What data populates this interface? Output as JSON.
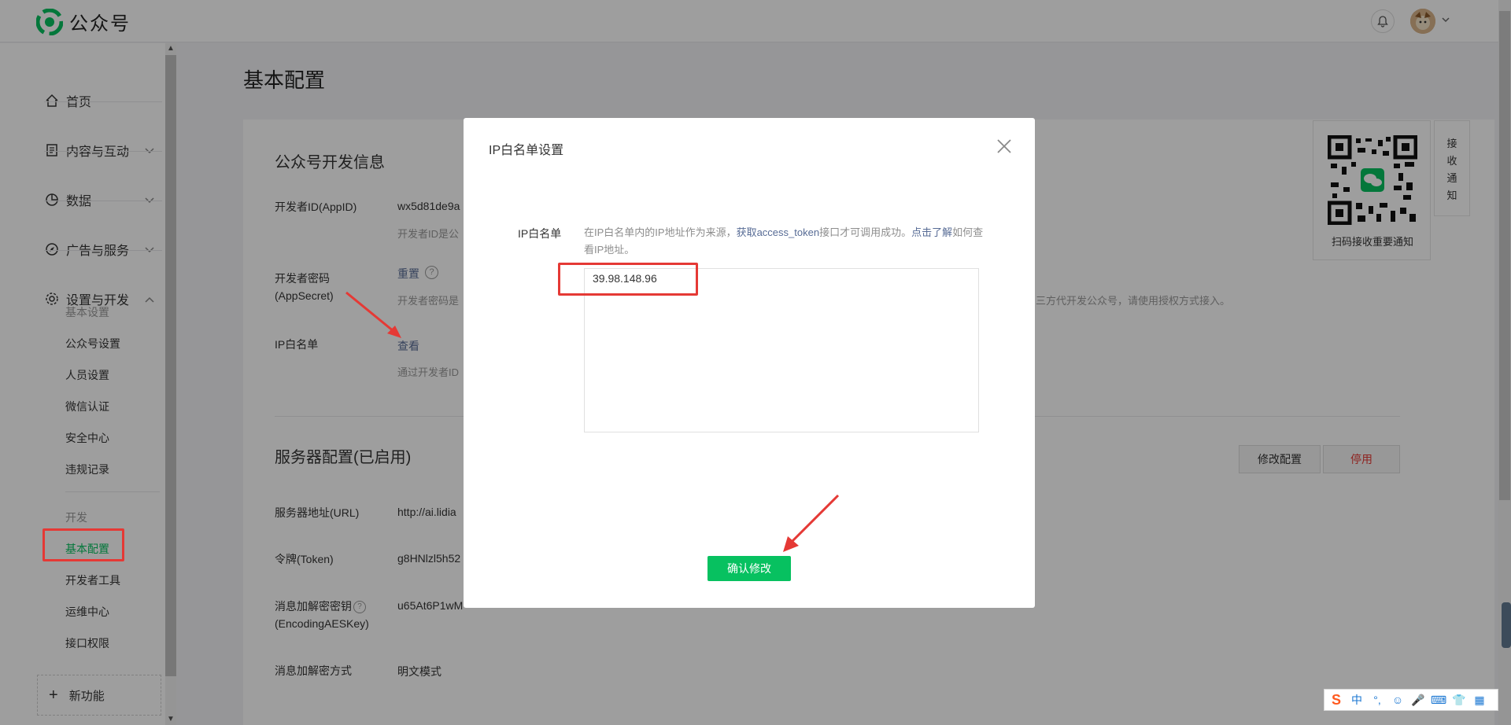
{
  "app": {
    "name": "公众号",
    "brand_color": "#07c160"
  },
  "sidebar": {
    "nav": [
      {
        "label": "首页",
        "icon": "home-icon"
      },
      {
        "label": "内容与互动",
        "icon": "document-icon"
      },
      {
        "label": "数据",
        "icon": "pie-chart-icon"
      },
      {
        "label": "广告与服务",
        "icon": "compass-icon"
      },
      {
        "label": "设置与开发",
        "icon": "gear-icon"
      }
    ],
    "settings_group": {
      "heading": "基本设置",
      "items": [
        "公众号设置",
        "人员设置",
        "微信认证",
        "安全中心",
        "违规记录"
      ]
    },
    "dev_group": {
      "heading": "开发",
      "items": [
        "基本配置",
        "开发者工具",
        "运维中心",
        "接口权限"
      ]
    },
    "new_feature": "新功能"
  },
  "main": {
    "page_title": "基本配置",
    "dev_info": {
      "title": "公众号开发信息",
      "appid_label": "开发者ID(AppID)",
      "appid_value": "wx5d81de9a",
      "appid_hint": "开发者ID是公",
      "secret_label": "开发者密码(AppSecret)",
      "secret_action": "重置",
      "secret_hint": "开发者密码是",
      "secret_hint_right": "三方代开发公众号，请使用授权方式接入。",
      "ip_label": "IP白名单",
      "ip_action": "查看",
      "ip_hint": "通过开发者ID"
    },
    "server": {
      "title": "服务器配置(已启用)",
      "modify_btn": "修改配置",
      "disable_btn": "停用",
      "url_label": "服务器地址(URL)",
      "url_value": "http://ai.lidia",
      "token_label": "令牌(Token)",
      "token_value": "g8HNlzl5h52",
      "aes_label": "消息加解密密钥",
      "aes_label2": "(EncodingAESKey)",
      "aes_value": "u65At6P1wM",
      "mode_label": "消息加解密方式",
      "mode_value": "明文模式"
    },
    "qr": {
      "caption": "扫码接收重要通知"
    },
    "notify_tab": [
      "接",
      "收",
      "通",
      "知"
    ]
  },
  "modal": {
    "title": "IP白名单设置",
    "field_label": "IP白名单",
    "hint_pre": "在IP白名单内的IP地址作为来源，",
    "hint_link1": "获取access_token",
    "hint_mid": "接口才可调用成功。",
    "hint_link2": "点击了解",
    "hint_post": "如何查看IP地址。",
    "ip_value": "39.98.148.96",
    "confirm": "确认修改"
  },
  "ime": [
    "中",
    "°,",
    "☺",
    "🎤",
    "⌨",
    "👕",
    "▦"
  ]
}
